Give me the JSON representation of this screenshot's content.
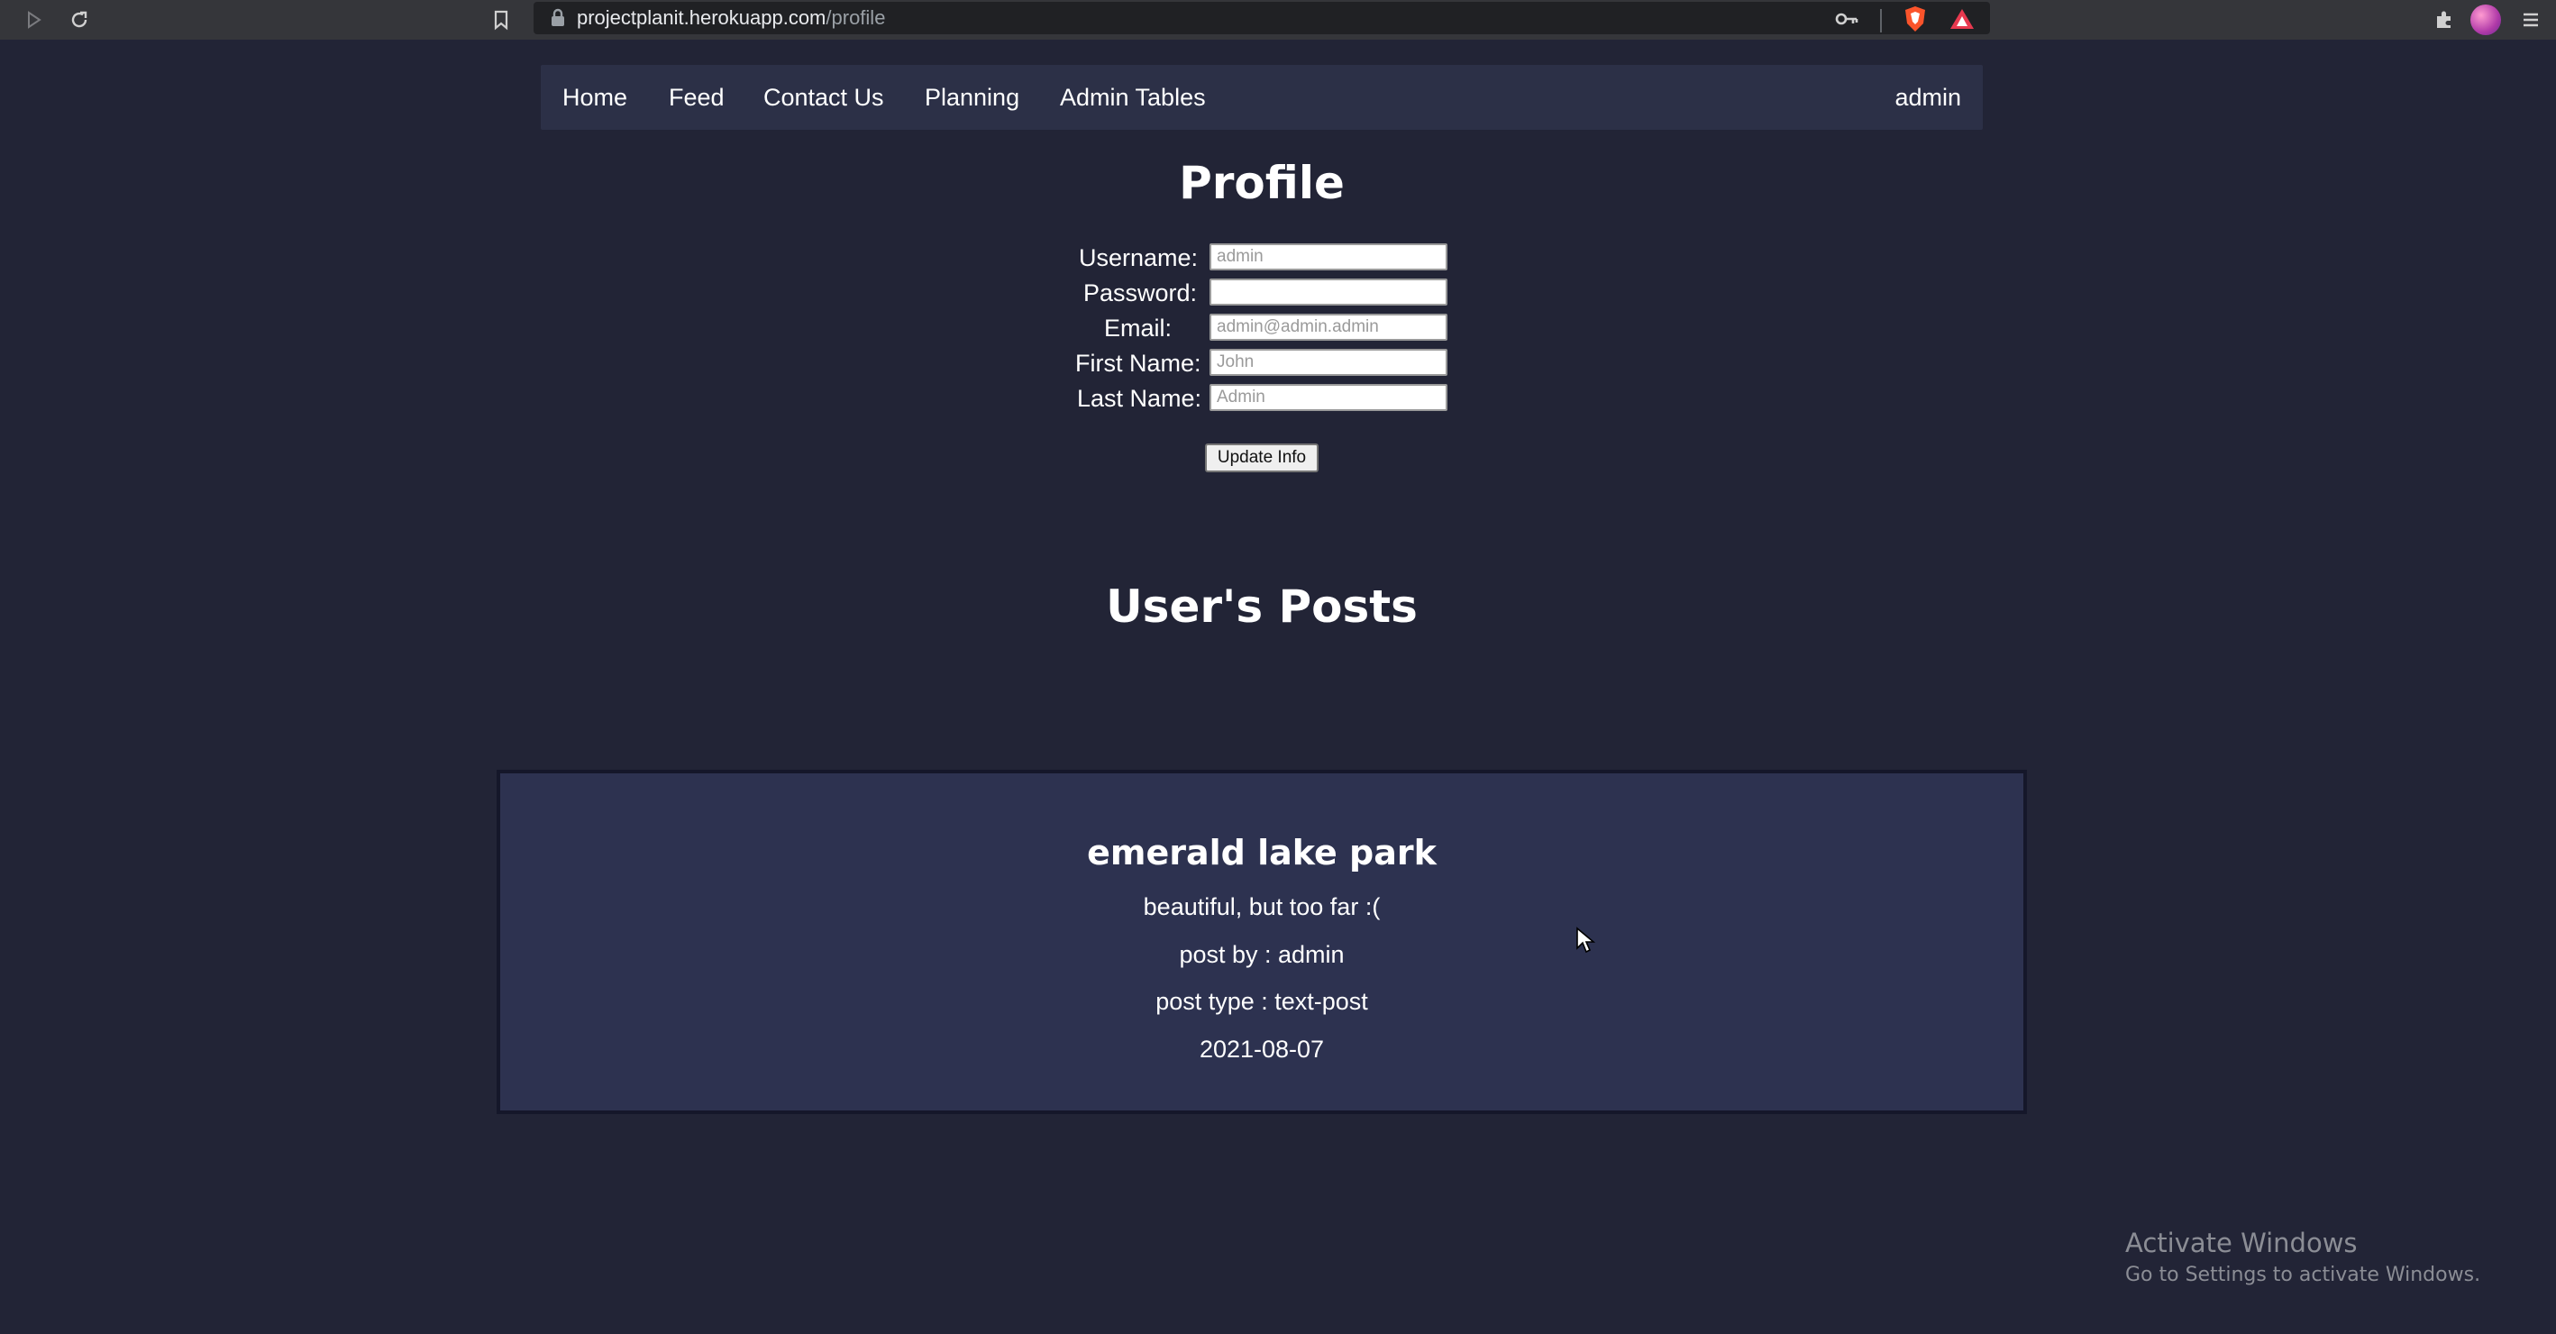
{
  "browser": {
    "url_host": "projectplanit.herokuapp.com",
    "url_path": "/profile",
    "icons": {
      "back": "back-arrow-icon",
      "forward": "forward-arrow-icon",
      "reload": "reload-icon",
      "bookmark": "bookmark-icon",
      "lock": "lock-icon",
      "key": "key-icon",
      "brave": "brave-shield-icon",
      "rewards": "brave-rewards-icon",
      "extensions": "puzzle-icon",
      "profile": "profile-avatar-icon",
      "menu": "hamburger-menu-icon"
    }
  },
  "nav": {
    "items": [
      "Home",
      "Feed",
      "Contact Us",
      "Planning",
      "Admin Tables"
    ],
    "user": "admin"
  },
  "profile": {
    "title": "Profile",
    "fields": [
      {
        "label": "Username:",
        "placeholder": "admin",
        "value": ""
      },
      {
        "label": "Password:",
        "placeholder": "",
        "value": ""
      },
      {
        "label": "Email:",
        "placeholder": "admin@admin.admin",
        "value": ""
      },
      {
        "label": "First Name:",
        "placeholder": "John",
        "value": ""
      },
      {
        "label": "Last Name:",
        "placeholder": "Admin",
        "value": ""
      }
    ],
    "submit_label": "Update Info"
  },
  "posts": {
    "title": "User's Posts",
    "items": [
      {
        "title": "emerald lake park",
        "body": "beautiful, but too far :(",
        "author": "post by : admin",
        "type": "post type : text-post",
        "date": "2021-08-07"
      }
    ]
  },
  "watermark": {
    "title": "Activate Windows",
    "subtitle": "Go to Settings to activate Windows."
  },
  "colors": {
    "page_bg": "#222436",
    "nav_bg": "#2c3047",
    "card_bg": "#2d3250",
    "chrome_bg": "#35363a"
  }
}
